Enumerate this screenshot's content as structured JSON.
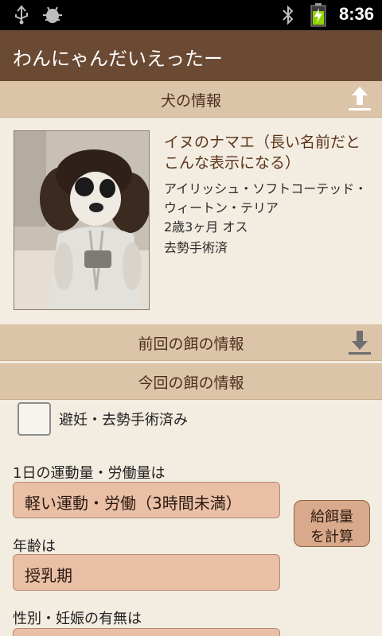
{
  "status_bar": {
    "time": "8:36",
    "icons": [
      "usb-icon",
      "android-debug-icon",
      "bluetooth-icon",
      "battery-charging-icon"
    ]
  },
  "app": {
    "title": "わんにゃんだいえったー"
  },
  "dog_section": {
    "header": "犬の情報",
    "header_icon": "upload-arrow-icon",
    "name": "イヌのナマエ（長い名前だとこんな表示になる）",
    "breed": "アイリッシュ・ソフトコーテッド・ウィートン・テリア",
    "age_sex": "2歳3ヶ月  オス",
    "neuter_status": "去勢手術済"
  },
  "previous_food": {
    "header": "前回の餌の情報",
    "header_icon": "download-arrow-icon"
  },
  "current_food": {
    "header": "今回の餌の情報",
    "checkbox_label": "避妊・去勢手術済み",
    "checkbox_checked": false,
    "activity_label": "1日の運動量・労働量は",
    "activity_value": "軽い運動・労働（3時間未満）",
    "age_label": "年齢は",
    "age_value": "授乳期",
    "sex_label": "性別・妊娠の有無は",
    "calc_button_line1": "給餌量",
    "calc_button_line2": "を計算"
  },
  "colors": {
    "title_bar": "#6b4a33",
    "section_header": "#dcc4a8",
    "background": "#f3ece1",
    "dropdown": "#e9bfa6",
    "button": "#d9a98c"
  }
}
